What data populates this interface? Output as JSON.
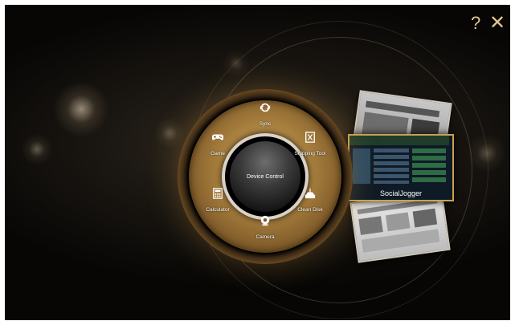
{
  "window": {
    "help_icon": "?",
    "close_icon": "✕"
  },
  "wheel": {
    "center_label": "Device Control",
    "items": [
      {
        "label": "Sync",
        "icon": "sync-icon"
      },
      {
        "label": "Snipping Tool",
        "icon": "scissors-icon"
      },
      {
        "label": "Clean Disk",
        "icon": "clean-disk-icon"
      },
      {
        "label": "Camera",
        "icon": "camera-icon"
      },
      {
        "label": "Calculator",
        "icon": "calculator-icon"
      },
      {
        "label": "Game",
        "icon": "gamepad-icon"
      }
    ]
  },
  "app_switcher": {
    "selected_label": "SocialJogger"
  },
  "colors": {
    "accent_gold": "#c9a24f",
    "wheel_gold": "#a8803f",
    "background_dark": "#070605"
  }
}
